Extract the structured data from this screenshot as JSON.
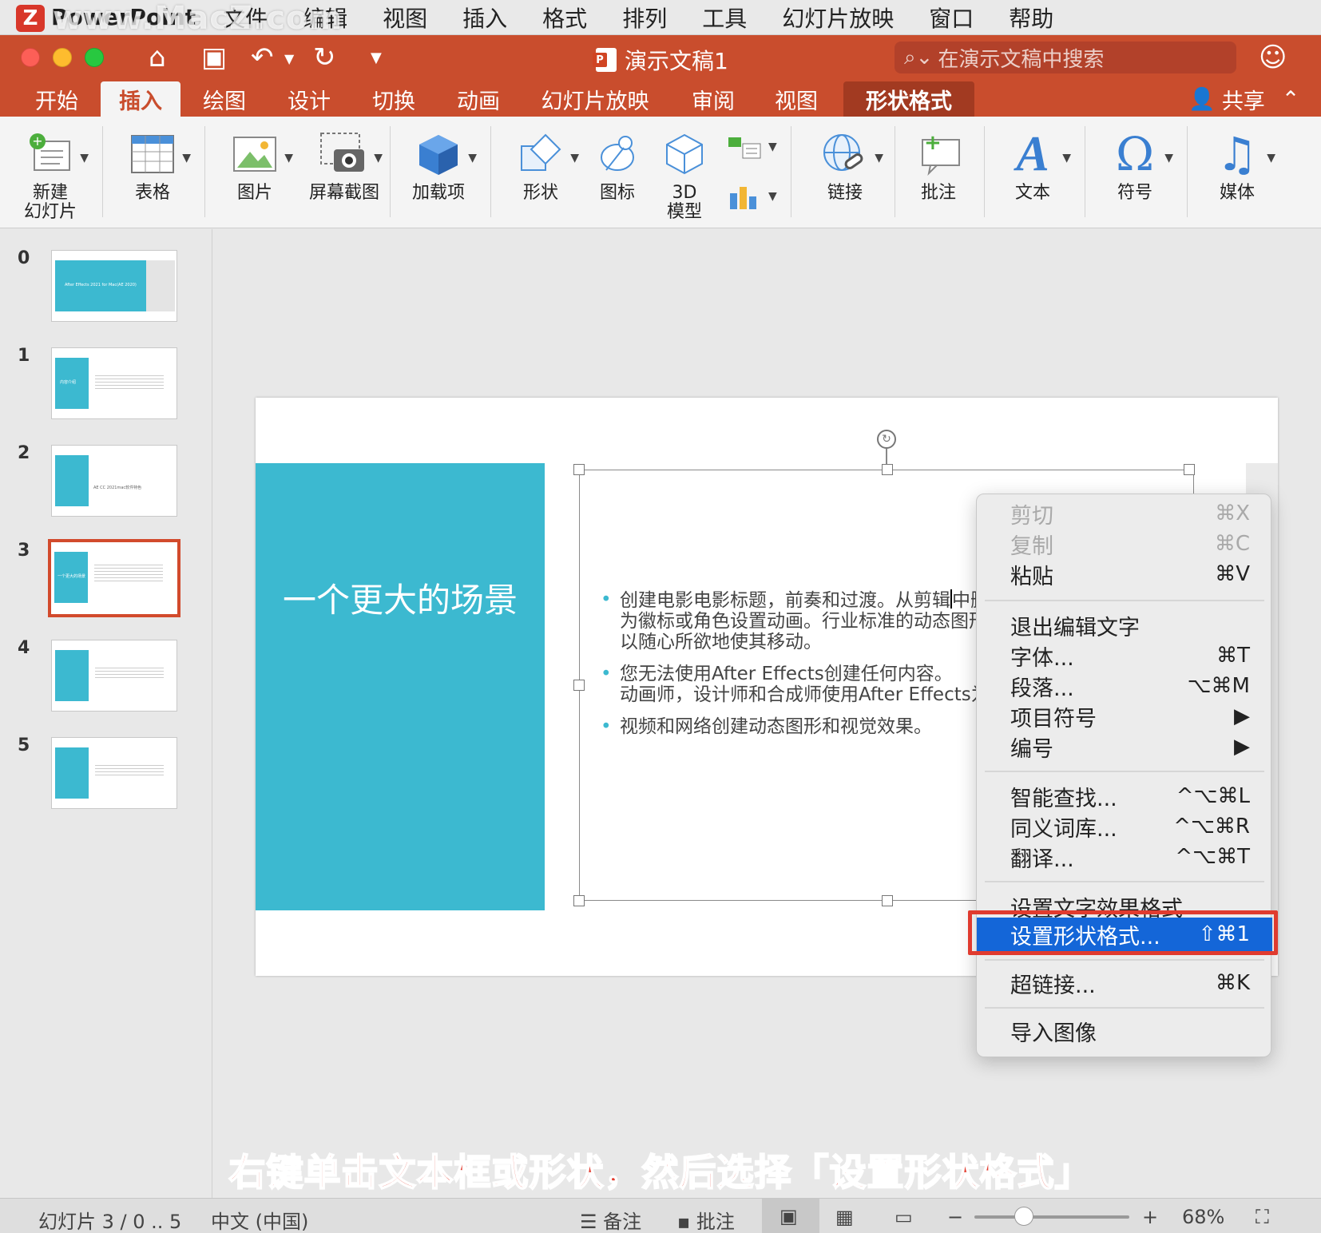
{
  "menubar": {
    "app": "PowerPoint",
    "items": [
      "文件",
      "编辑",
      "视图",
      "插入",
      "格式",
      "排列",
      "工具",
      "幻灯片放映",
      "窗口",
      "帮助"
    ],
    "watermark": "www.MacZ.com"
  },
  "titlebar": {
    "doc_title": "演示文稿1",
    "search_placeholder": "在演示文稿中搜索"
  },
  "tabs": [
    "开始",
    "插入",
    "绘图",
    "设计",
    "切换",
    "动画",
    "幻灯片放映",
    "审阅",
    "视图",
    "形状格式"
  ],
  "active_tab": "插入",
  "share": "共享",
  "ribbon": [
    {
      "label": "新建\n幻灯片",
      "icon": "new-slide-icon"
    },
    {
      "label": "表格",
      "icon": "table-icon"
    },
    {
      "label": "图片",
      "icon": "picture-icon"
    },
    {
      "label": "屏幕截图",
      "icon": "screenshot-icon"
    },
    {
      "label": "加载项",
      "icon": "addins-icon"
    },
    {
      "label": "形状",
      "icon": "shapes-icon"
    },
    {
      "label": "图标",
      "icon": "icons-icon"
    },
    {
      "label": "3D\n模型",
      "icon": "3d-model-icon"
    },
    {
      "label": "链接",
      "icon": "link-icon"
    },
    {
      "label": "批注",
      "icon": "comment-icon"
    },
    {
      "label": "文本",
      "icon": "text-icon"
    },
    {
      "label": "符号",
      "icon": "symbol-icon"
    },
    {
      "label": "媒体",
      "icon": "media-icon"
    }
  ],
  "thumbnails": [
    {
      "num": "0",
      "text": "After Effects 2021 for Mac(AE 2020)"
    },
    {
      "num": "1",
      "text": "内容介绍"
    },
    {
      "num": "2",
      "text": "AE CC 2021mac软件特色"
    },
    {
      "num": "3",
      "text": "一个更大的场景"
    },
    {
      "num": "4",
      "text": ""
    },
    {
      "num": "5",
      "text": ""
    }
  ],
  "slide": {
    "title": "一个更大的场景",
    "bullets": [
      [
        "创建电影电影标题，前奏和过渡。从剪辑中删",
        "为徽标或角色设置动画。行业标准的动态图形",
        "以随心所欲地使其移动。"
      ],
      [
        "您无法使用After Effects创建任何内容。",
        "动画师，设计师和合成师使用After Effects为"
      ],
      [
        "视频和网络创建动态图形和视觉效果。"
      ]
    ]
  },
  "context_menu": [
    {
      "label": "剪切",
      "shortcut": "⌘X",
      "disabled": true
    },
    {
      "label": "复制",
      "shortcut": "⌘C",
      "disabled": true
    },
    {
      "label": "粘贴",
      "shortcut": "⌘V",
      "disabled": false
    },
    {
      "label": "退出编辑文字",
      "shortcut": "",
      "disabled": false
    },
    {
      "label": "字体...",
      "shortcut": "⌘T",
      "disabled": false
    },
    {
      "label": "段落...",
      "shortcut": "⌥⌘M",
      "disabled": false
    },
    {
      "label": "项目符号",
      "shortcut": "▶",
      "disabled": false
    },
    {
      "label": "编号",
      "shortcut": "▶",
      "disabled": false
    },
    {
      "label": "智能查找...",
      "shortcut": "^⌥⌘L",
      "disabled": false
    },
    {
      "label": "同义词库...",
      "shortcut": "^⌥⌘R",
      "disabled": false
    },
    {
      "label": "翻译...",
      "shortcut": "^⌥⌘T",
      "disabled": false
    },
    {
      "label": "设置文字效果格式",
      "shortcut": "",
      "disabled": false
    },
    {
      "label": "设置形状格式...",
      "shortcut": "⇧⌘1",
      "disabled": false,
      "highlighted": true
    },
    {
      "label": "超链接...",
      "shortcut": "⌘K",
      "disabled": false
    },
    {
      "label": "导入图像",
      "shortcut": "",
      "disabled": false
    }
  ],
  "caption": "右键单击文本框或形状，然后选择「设置形状格式」",
  "statusbar": {
    "slide_info": "幻灯片 3 / 0 .. 5",
    "language": "中文 (中国)",
    "notes": "备注",
    "comments": "批注",
    "zoom": "68%"
  },
  "colors": {
    "accent": "#c94d2d",
    "slide_block": "#3cb9d0",
    "menu_highlight": "#1466d8",
    "callout_red": "#e03b2f"
  }
}
